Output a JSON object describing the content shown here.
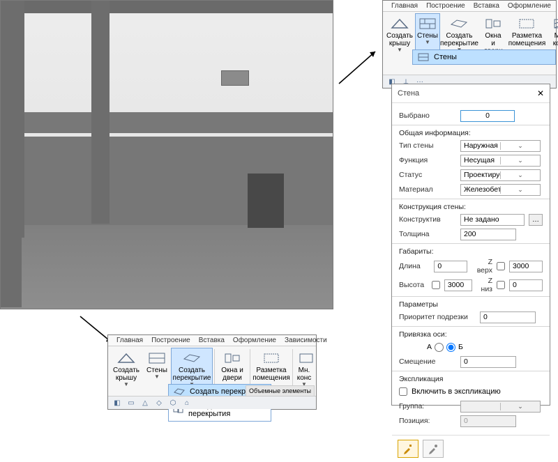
{
  "ribbon_tabs": [
    "Главная",
    "Построение",
    "Вставка",
    "Оформление",
    "Зависимости"
  ],
  "ribbon_top": {
    "tools": {
      "roof": {
        "label": "Создать\nкрышу"
      },
      "walls": {
        "label": "Стены"
      },
      "slab": {
        "label": "Создать\nперекрытие"
      },
      "openings": {
        "label": "Окна\nи двери"
      },
      "roomtag": {
        "label": "Разметка\nпомещения"
      },
      "more": {
        "label": "Мн.\nконс"
      }
    },
    "dropdown": {
      "walls_item": "Стены"
    }
  },
  "ribbon_bottom": {
    "tools": {
      "roof": {
        "label": "Создать\nкрышу"
      },
      "walls": {
        "label": "Стены"
      },
      "slab": {
        "label": "Создать\nперекрытие"
      },
      "openings": {
        "label": "Окна\nи двери"
      },
      "roomtag": {
        "label": "Разметка\nпомещения"
      },
      "more": {
        "label": "Мн.\nконс"
      }
    },
    "dropdown": {
      "create_slab": "Создать перекрытие",
      "merge_slabs": "Объединить перекрытия"
    },
    "volumes_tab": "Объемные элементы"
  },
  "props": {
    "title": "Стена",
    "selected_label": "Выбрано",
    "selected_value": "0",
    "sec_general": "Общая информация:",
    "type_label": "Тип стены",
    "type_value": "Наружная стена",
    "func_label": "Функция",
    "func_value": "Несущая",
    "status_label": "Статус",
    "status_value": "Проектируемая",
    "mat_label": "Материал",
    "mat_value": "Железобетон",
    "sec_construction": "Конструкция стены:",
    "constr_label": "Конструктив",
    "constr_value": "Не задано",
    "thk_label": "Толщина",
    "thk_value": "200",
    "sec_size": "Габариты:",
    "len_label": "Длина",
    "len_value": "0",
    "ztop_label": "Z верх",
    "ztop_value": "3000",
    "h_label": "Высота",
    "h_value": "3000",
    "zbot_label": "Z низ",
    "zbot_value": "0",
    "sec_params": "Параметры",
    "prio_label": "Приоритет подрезки",
    "prio_value": "0",
    "sec_axis": "Привязка оси:",
    "opt_a": "А",
    "opt_b": "Б",
    "offset_label": "Смещение",
    "offset_value": "0",
    "sec_expl": "Экспликация",
    "incl_label": "Включить в экспликацию",
    "group_label": "Группа:",
    "pos_label": "Позиция:",
    "pos_value": "0"
  }
}
